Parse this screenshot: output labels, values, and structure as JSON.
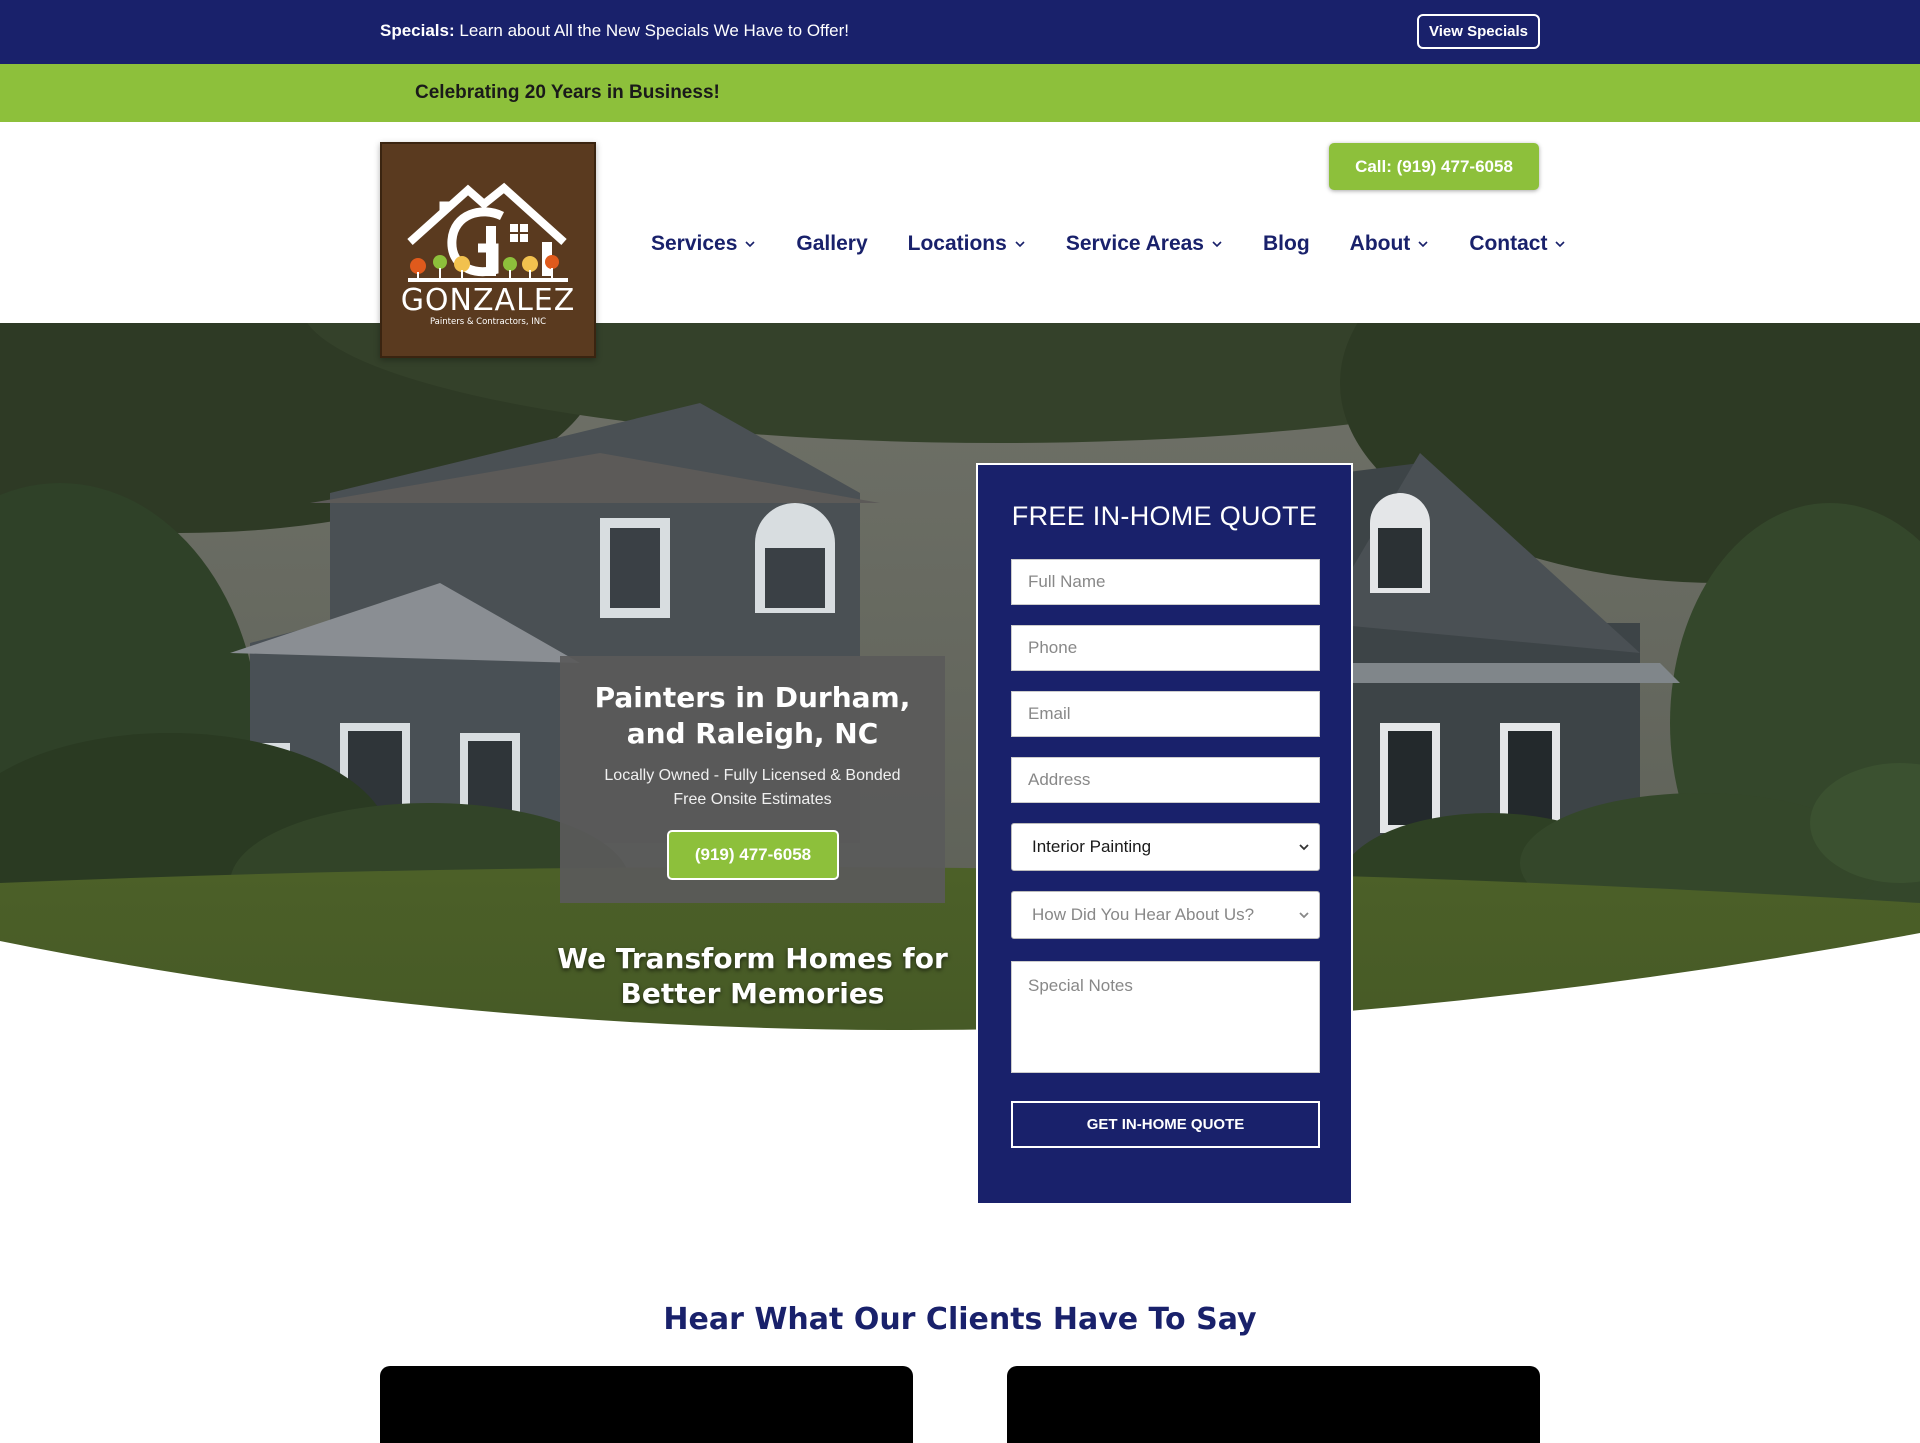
{
  "topbar": {
    "specials_label": "Specials:",
    "specials_text": " Learn about All the New Specials We Have to Offer!",
    "view_button": "View Specials"
  },
  "announcement": "Celebrating 20 Years in Business!",
  "header": {
    "logo_text": "GONZALEZ",
    "logo_subtext": "Painters & Contractors, INC",
    "call_button": "Call: (919) 477-6058",
    "nav": [
      {
        "label": "Services",
        "has_dropdown": true
      },
      {
        "label": "Gallery",
        "has_dropdown": false
      },
      {
        "label": "Locations",
        "has_dropdown": true
      },
      {
        "label": "Service Areas",
        "has_dropdown": true
      },
      {
        "label": "Blog",
        "has_dropdown": false
      },
      {
        "label": "About",
        "has_dropdown": true
      },
      {
        "label": "Contact",
        "has_dropdown": true
      }
    ]
  },
  "hero": {
    "title_line1": "Painters in Durham,",
    "title_line2": "and Raleigh, NC",
    "sub_line1": "Locally Owned - Fully Licensed & Bonded",
    "sub_line2": "Free Onsite Estimates",
    "phone_button": "(919) 477-6058",
    "tagline_line1": "We Transform Homes for",
    "tagline_line2": "Better Memories"
  },
  "quote_form": {
    "title": "FREE IN-HOME QUOTE",
    "full_name_placeholder": "Full Name",
    "phone_placeholder": "Phone",
    "email_placeholder": "Email",
    "address_placeholder": "Address",
    "service_selected": "Interior Painting",
    "referral_selected": "How Did You Hear About Us?",
    "notes_placeholder": "Special Notes",
    "submit": "GET IN-HOME QUOTE"
  },
  "testimonials": {
    "heading": "Hear What Our Clients Have To Say"
  },
  "colors": {
    "navy": "#19216b",
    "green": "#8dc03b",
    "brown": "#5a3a1f"
  }
}
